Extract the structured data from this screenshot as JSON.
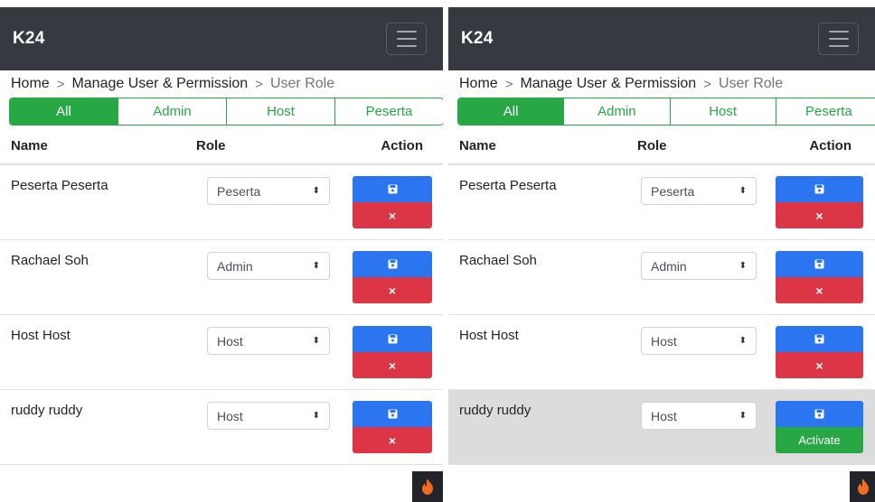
{
  "app": {
    "brand": "K24"
  },
  "breadcrumb": {
    "home": "Home",
    "sep": ">",
    "section": "Manage User & Permission",
    "current": "User Role"
  },
  "tabs": [
    "All",
    "Admin",
    "Host",
    "Peserta"
  ],
  "table": {
    "headers": {
      "name": "Name",
      "role": "Role",
      "action": "Action"
    }
  },
  "screen_left": {
    "rows": [
      {
        "name": "Peserta Peserta",
        "role": "Peserta",
        "delete_label": "×"
      },
      {
        "name": "Rachael Soh",
        "role": "Admin",
        "delete_label": "×"
      },
      {
        "name": "Host Host",
        "role": "Host",
        "delete_label": "×"
      },
      {
        "name": "ruddy ruddy",
        "role": "Host",
        "delete_label": "×"
      }
    ]
  },
  "screen_right": {
    "rows": [
      {
        "name": "Peserta Peserta",
        "role": "Peserta",
        "delete_label": "×"
      },
      {
        "name": "Rachael Soh",
        "role": "Admin",
        "delete_label": "×"
      },
      {
        "name": "Host Host",
        "role": "Host",
        "delete_label": "×"
      },
      {
        "name": "ruddy ruddy",
        "role": "Host",
        "activate_label": "Activate"
      }
    ]
  },
  "colors": {
    "navbar": "#343a40",
    "success": "#28a745",
    "primary": "#2b76f0",
    "danger": "#dc3545",
    "inactive_row": "#dcdcdc"
  },
  "icons": {
    "select_arrow": "⬍",
    "save": "floppy-disk-icon",
    "delete": "close-icon",
    "hamburger": "hamburger-icon",
    "fab": "flame-icon"
  }
}
